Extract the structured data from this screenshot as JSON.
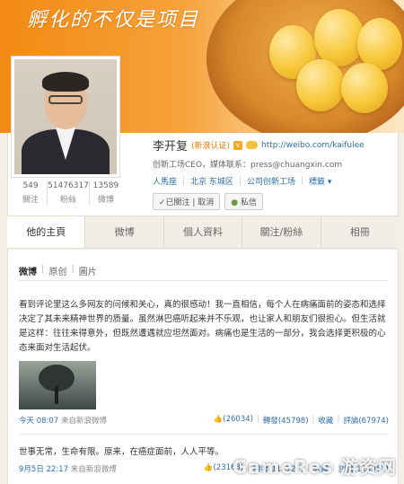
{
  "banner": {
    "slogan": "孵化的不仅是项目"
  },
  "profile": {
    "name": "李开复",
    "verify_label": "(新浪认证)",
    "website": "http://weibo.com/kaifulee",
    "bio": "创新工场CEO，媒体联系：press@chuangxin.com",
    "meta": [
      "人馬座",
      "北京 东城区",
      "公司创新工场",
      "標籤 ▾"
    ],
    "stats": [
      {
        "num": "549",
        "label": "關注"
      },
      {
        "num": "51476317",
        "label": "粉絲"
      },
      {
        "num": "13589",
        "label": "微博"
      }
    ],
    "follow_button": "✓已關注 | 取消",
    "message_button": "私信"
  },
  "tabs": [
    "他的主頁",
    "微博",
    "個人資料",
    "關注/粉絲",
    "相冊"
  ],
  "subtabs": [
    "微博",
    "原创",
    "圖片"
  ],
  "posts": [
    {
      "text": "看到评论里这么多网友的问候和关心，真的很感动！我一直相信，每个人在病痛面前的姿态和选择决定了其未来精神世界的质量。虽然淋巴癌听起来并不乐观，也让家人和朋友们很担心。但生活就是这样：往往来得意外，但既然遭遇就应坦然面对。病痛也是生活的一部分，我会选择更积极的心态来面对生活起伏。",
      "time": "今天 08:07",
      "source": "来自新浪微博",
      "likes": "(26034)",
      "reposts": "轉發(45798)",
      "favorite": "收藏",
      "comments": "評論(67974)"
    },
    {
      "text": "世事无常，生命有限。原来，在癌症面前，人人平等。",
      "time": "9月5日 22:17",
      "source": "来自新浪微博",
      "likes": "(23163)",
      "reposts": "轉發(114727)",
      "favorite": "收藏",
      "comments": "評論(114957)"
    }
  ],
  "watermark": "GameRes 游资网",
  "colors": {
    "banner": "#f28a12",
    "link": "#2b6ea8",
    "accent": "#e07a00"
  }
}
